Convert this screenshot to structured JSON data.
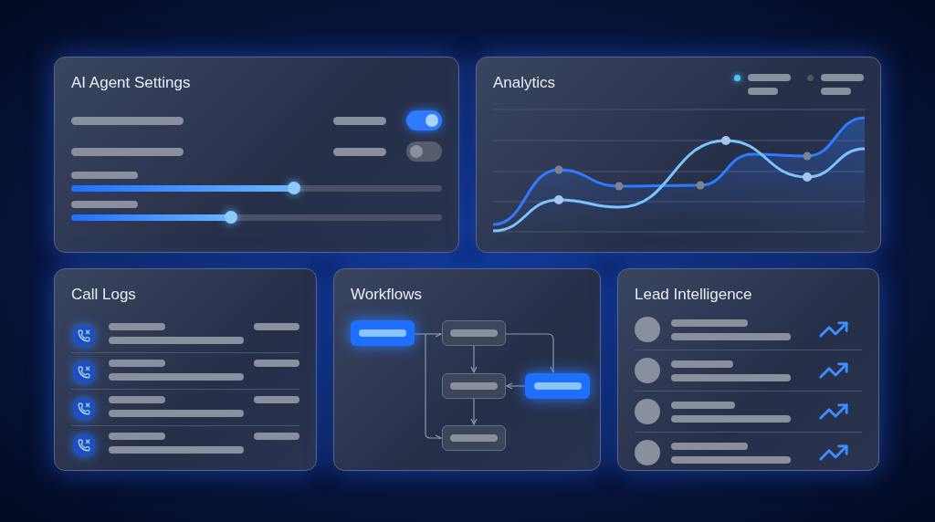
{
  "settings": {
    "title": "AI Agent Settings",
    "toggles": [
      {
        "on": true
      },
      {
        "on": false
      }
    ],
    "sliders": [
      {
        "level": 0.6
      },
      {
        "level": 0.43
      }
    ]
  },
  "analytics": {
    "title": "Analytics",
    "legend": [
      {
        "color": "#4fc3f7"
      },
      {
        "color": "#4b5563"
      }
    ]
  },
  "call_logs": {
    "title": "Call Logs"
  },
  "workflows": {
    "title": "Workflows",
    "nodes": [
      {
        "highlighted": true
      },
      {
        "highlighted": false
      },
      {
        "highlighted": false
      },
      {
        "highlighted": true
      },
      {
        "highlighted": false
      }
    ]
  },
  "lead_intelligence": {
    "title": "Lead Intelligence"
  }
}
